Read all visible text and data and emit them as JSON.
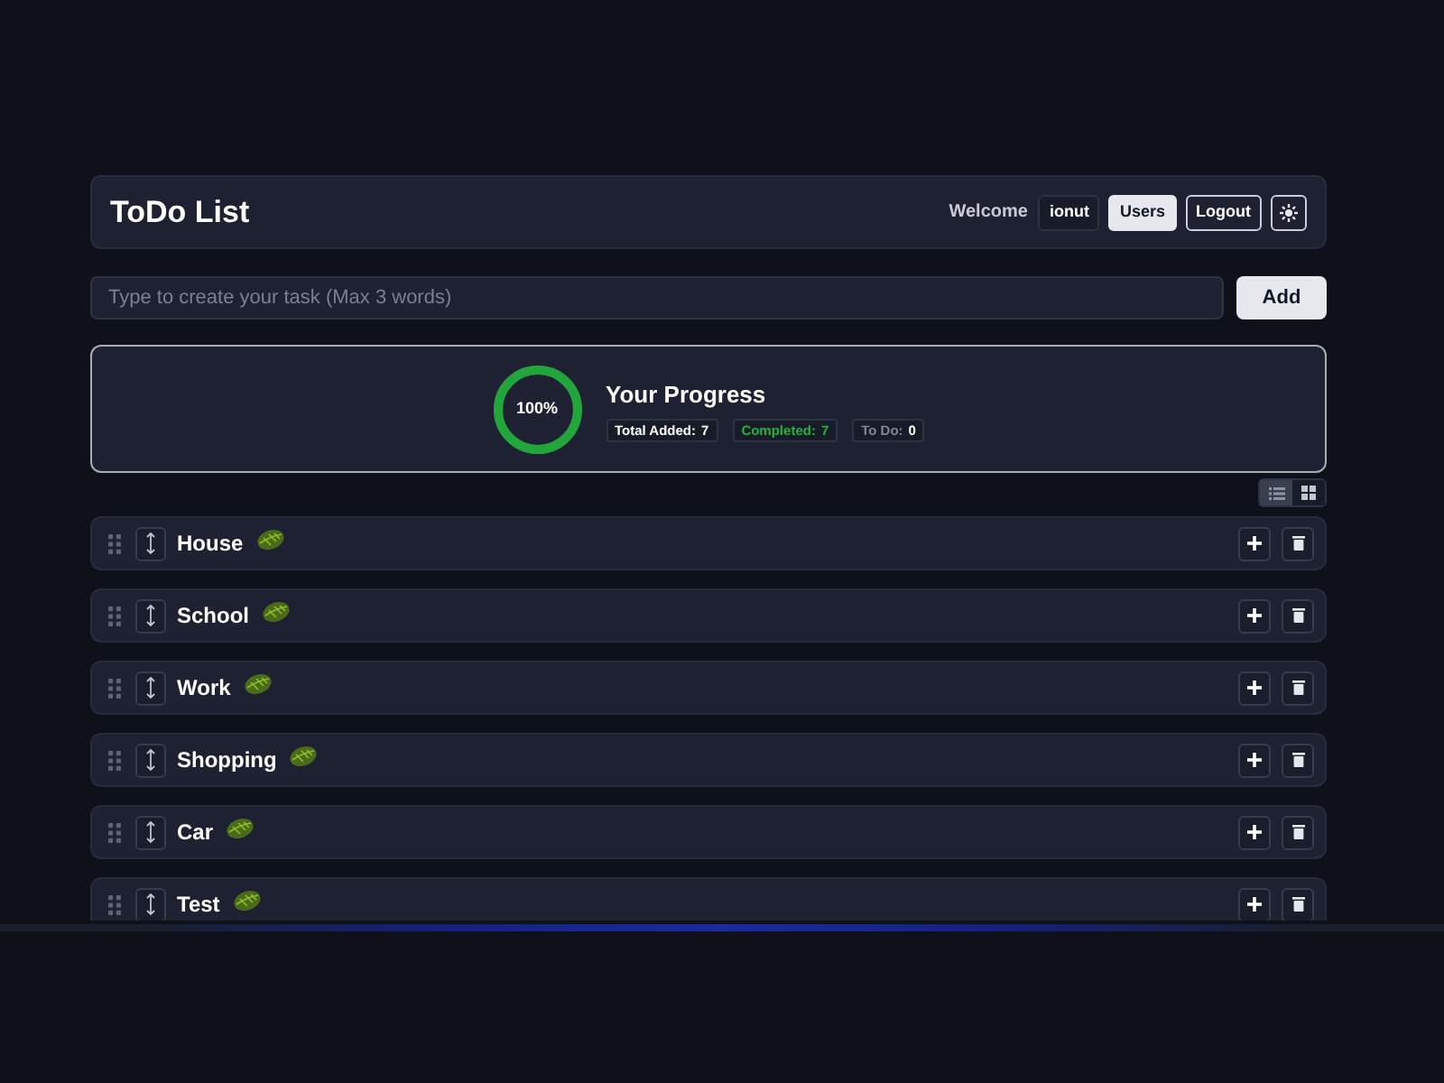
{
  "header": {
    "title": "ToDo List",
    "welcome": "Welcome",
    "user": "ionut",
    "buttons": [
      {
        "label": "Users",
        "kind": "filled"
      },
      {
        "label": "Logout",
        "kind": "outline"
      }
    ]
  },
  "task_input": {
    "placeholder": "Type to create your task (Max 3 words)",
    "button": "Add"
  },
  "progress": {
    "percent": "100%",
    "level": 1,
    "title": "Your Progress",
    "stats": [
      {
        "kind": "total",
        "label": "Total Added:",
        "value": "7"
      },
      {
        "kind": "completed",
        "label": "Completed:",
        "value": "7"
      },
      {
        "kind": "todo",
        "label": "To Do:",
        "value": "0"
      }
    ]
  },
  "view_toggle": [
    {
      "kind": "list",
      "selected": true
    },
    {
      "kind": "grid",
      "selected": false
    }
  ],
  "categories": [
    {
      "name": "House"
    },
    {
      "name": "School"
    },
    {
      "name": "Work"
    },
    {
      "name": "Shopping"
    },
    {
      "name": "Car"
    },
    {
      "name": "Test"
    }
  ]
}
